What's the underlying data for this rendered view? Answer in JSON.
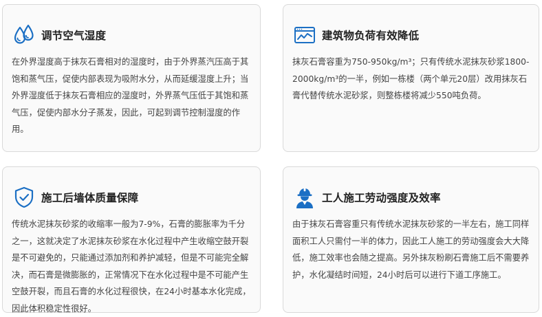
{
  "colors": {
    "icon_blue": "#1b6fc4",
    "card_border": "#d9d9d9",
    "card_bg": "#fafafa"
  },
  "cards": [
    {
      "icon": "water-drops-icon",
      "title": "调节空气湿度",
      "body": "在外界湿度高于抹灰石膏相对的湿度时，由于外界蒸汽压高于其饱和蒸气压，促使内部表现为吸附水分，从而延缓湿度上升；当外界湿度低于抹灰石膏相应的湿度时，外界蒸气压低于其饱和蒸气压，促使内部水分子蒸发，因此，可起到调节控制湿度的作用。"
    },
    {
      "icon": "monitor-chart-icon",
      "title": "建筑物负荷有效降低",
      "body": "抹灰石膏容重为750-950kg/m³；只有传统水泥抹灰砂浆1800-2000kg/m³的一半，例如一栋楼（两个单元20层）改用抹灰石膏代替传统水泥砂浆，则整栋楼将减少550吨负荷。"
    },
    {
      "icon": "shield-check-icon",
      "title": "施工后墙体质量保障",
      "body": "传统水泥抹灰砂浆的收缩率一般为7-9%，石膏的膨胀率为千分之一，这就决定了水泥抹灰砂浆在水化过程中产生收缩空鼓开裂是不可避免的，只能通过添加剂和养护减轻，但是不可能完全解决，而石膏是微膨胀的，正常情况下在水化过程中是不可能产生空鼓开裂，而且石膏的水化过程很快，在24小时基本水化完成，因此体积稳定性很好。"
    },
    {
      "icon": "worker-helmet-icon",
      "title": "工人施工劳动强度及效率",
      "body": "由于抹灰石膏容重只有传统水泥抹灰砂浆的一半左右，施工同样面积工人只需付一半的体力，因此工人施工的劳动强度会大大降低，施工效率也会随之提高。另外抹灰粉刷石膏施工后不需要养护，水化凝结时间短，24小时后可以进行下道工序施工。"
    }
  ]
}
